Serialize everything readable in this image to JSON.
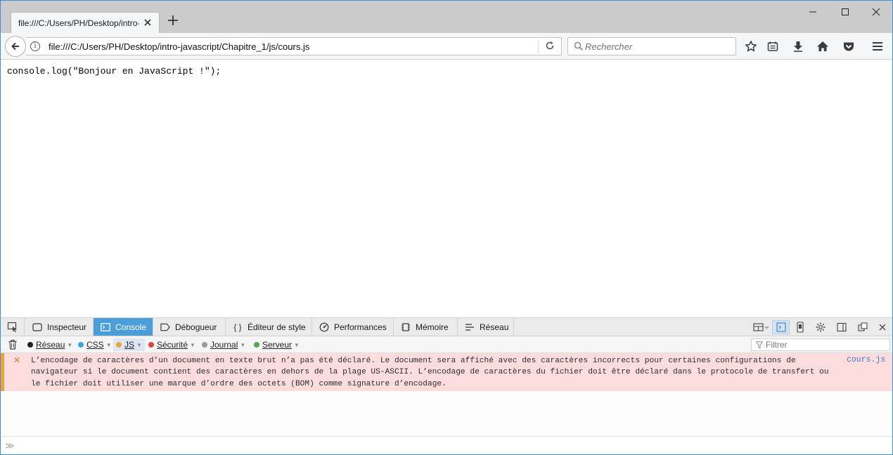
{
  "window": {
    "tab_title": "file:///C:/Users/PH/Desktop/intro-",
    "new_tab_label": "+"
  },
  "navbar": {
    "url": "file:///C:/Users/PH/Desktop/intro-javascript/Chapitre_1/js/cours.js",
    "search_placeholder": "Rechercher"
  },
  "page": {
    "code": "console.log(\"Bonjour en JavaScript !\");"
  },
  "devtools": {
    "tabs": [
      {
        "label": "Inspecteur",
        "icon": "inspector-icon"
      },
      {
        "label": "Console",
        "icon": "console-icon"
      },
      {
        "label": "Débogueur",
        "icon": "debugger-icon"
      },
      {
        "label": "Éditeur de style",
        "icon": "braces-icon"
      },
      {
        "label": "Performances",
        "icon": "performance-icon"
      },
      {
        "label": "Mémoire",
        "icon": "memory-icon"
      },
      {
        "label": "Réseau",
        "icon": "network-icon"
      }
    ],
    "active_tab": "Console",
    "filters": [
      {
        "label": "Réseau",
        "color": "#222222"
      },
      {
        "label": "CSS",
        "color": "#3ba4e0"
      },
      {
        "label": "JS",
        "color": "#f0a23a"
      },
      {
        "label": "Sécurité",
        "color": "#e04545"
      },
      {
        "label": "Journal",
        "color": "#9a9a9a"
      },
      {
        "label": "Serveur",
        "color": "#5aa35a"
      }
    ],
    "filter_placeholder": "Filtrer",
    "message": {
      "text": "L’encodage de caractères d’un document en texte brut n’a pas été déclaré. Le document sera affiché avec des caractères incorrects pour certaines configurations de navigateur si le document contient des caractères en dehors de la plage US-ASCII. L’encodage de caractères du fichier doit être déclaré dans le protocole de transfert ou le fichier doit utiliser une marque d’ordre des octets (BOM) comme signature d’encodage.",
      "source": "cours.js",
      "level_color": "#f0a23a"
    },
    "prompt_symbol": "≫"
  }
}
